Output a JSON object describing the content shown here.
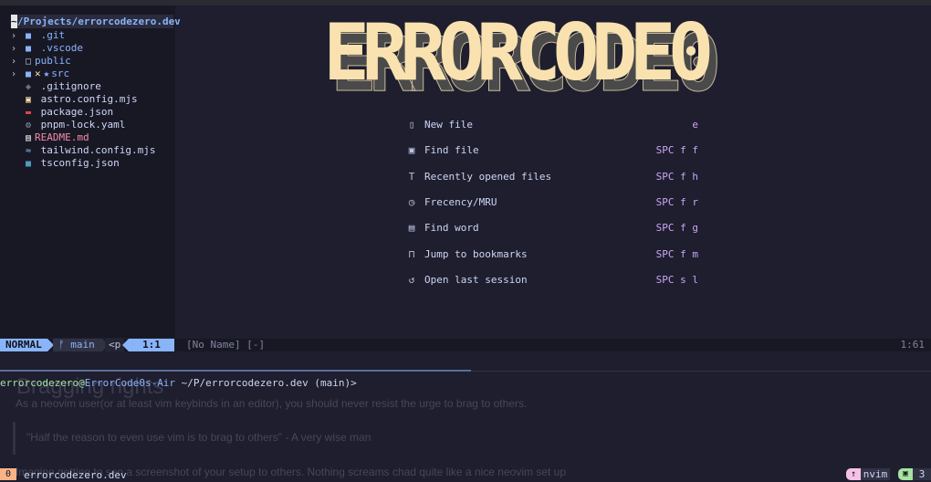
{
  "file_tree": {
    "root_cursor": "~",
    "root_path": "/Projects/errorcodezero.dev",
    "items": [
      {
        "name": ".git",
        "type": "folder",
        "icon": "folder-icon",
        "expandable": true
      },
      {
        "name": ".vscode",
        "type": "folder",
        "icon": "folder-icon",
        "expandable": true
      },
      {
        "name": "public",
        "type": "folder",
        "icon": "folder-open-outline-icon",
        "expandable": true
      },
      {
        "name": "src",
        "type": "folder",
        "icon": "folder-icon",
        "expandable": true,
        "git_status": "✕",
        "marker": "★"
      },
      {
        "name": ".gitignore",
        "type": "file",
        "icon": "git-icon"
      },
      {
        "name": "astro.config.mjs",
        "type": "file",
        "icon": "javascript-icon"
      },
      {
        "name": "package.json",
        "type": "file",
        "icon": "npm-icon"
      },
      {
        "name": "pnpm-lock.yaml",
        "type": "file",
        "icon": "gear-icon"
      },
      {
        "name": "README.md",
        "type": "file",
        "icon": "markdown-icon"
      },
      {
        "name": "tailwind.config.mjs",
        "type": "file",
        "icon": "tailwind-icon"
      },
      {
        "name": "tsconfig.json",
        "type": "file",
        "icon": "typescript-icon"
      }
    ]
  },
  "dashboard": {
    "banner": "ERRORCODE0",
    "actions": [
      {
        "icon": "new-file-icon",
        "label": "New file",
        "key": "e"
      },
      {
        "icon": "find-file-icon",
        "label": "Find file",
        "key": "SPC f f"
      },
      {
        "icon": "text-icon",
        "label": "Recently opened files",
        "key": "SPC f h"
      },
      {
        "icon": "history-icon",
        "label": "Frecency/MRU",
        "key": "SPC f r"
      },
      {
        "icon": "find-word-icon",
        "label": "Find word",
        "key": "SPC f g"
      },
      {
        "icon": "bookmark-icon",
        "label": "Jump to bookmarks",
        "key": "SPC f m"
      },
      {
        "icon": "restore-session-icon",
        "label": "Open last session",
        "key": "SPC s l"
      }
    ]
  },
  "statusline": {
    "mode": "NORMAL",
    "branch_icon": "ᚠ",
    "branch": "main",
    "pending_keys": "<p",
    "cursor_pos": "1:1",
    "buffer_name": "[No Name] [-]",
    "right_pos": "1:61"
  },
  "terminal": {
    "prompt_user": "errorcodezero",
    "prompt_at": "@",
    "prompt_host": "ErrorCode0s-Air",
    "prompt_path": " ~/P/errorcodezero.dev",
    "prompt_git": " (main)>",
    "background_page": {
      "title": "Bragging rights",
      "paragraph1": "As a neovim user(or at least vim keybinds in an editor), you should never resist the urge to brag to others.",
      "quote": "\"Half the reason to even use vim is to brag to others\" - A very wise man",
      "paragraph2": "Imagine getting to sen   a screenshot of your setup to others. Nothing screams chad quite like a nice neovim set up"
    }
  },
  "tmux": {
    "window_index": "0",
    "session_name": "errorcodezero.dev",
    "program_icon": "↑",
    "program": "nvim",
    "terminal_icon": "▣",
    "window_count": "3"
  }
}
